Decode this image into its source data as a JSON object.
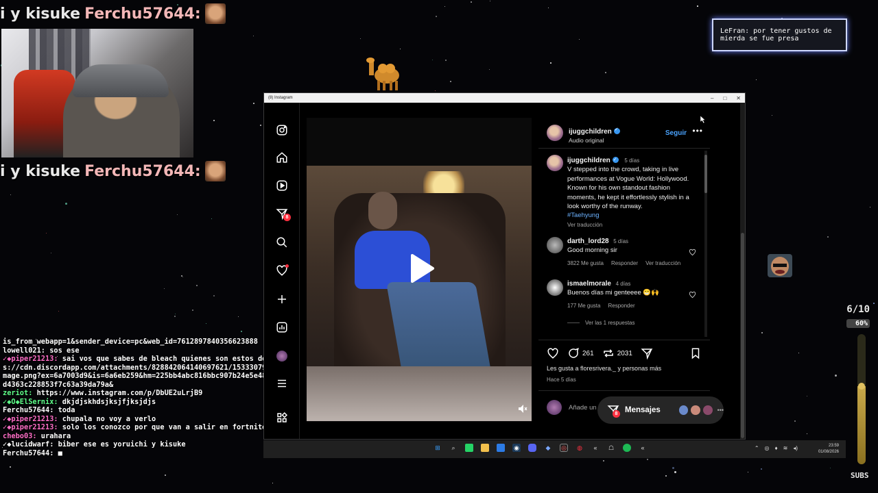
{
  "overlay": {
    "sub_banner_prefix": "i y kisuke",
    "sub_banner_name": "Ferchu57644:",
    "alert_text": "LeFran: por tener gustos de mierda se fue presa",
    "goal_count": "6/10",
    "goal_percent": "60%",
    "goal_progress": 0.6,
    "goal_label": "SUBS"
  },
  "chat": [
    {
      "user": "",
      "text": "is_from_webapp=1&sender_device=pc&web_id=7612897840356623888",
      "color": "plain"
    },
    {
      "user": "lowell021:",
      "text": "sos ese",
      "color": "plain"
    },
    {
      "user": "✓◆piper21213:",
      "text": "sai vos que sabes de bleach quienes son estos dos vro https://cdn.discordapp.com/attachments/828842064140697621/1533307993741856909/image.png?ex=6a7003d9&is=6a6eb259&hm=225bb4abc816bbc907b24e5e48a3c2d011c660dd4363c228853f7c63a39da79a&",
      "color": "pink"
    },
    {
      "user": "zeriot:",
      "text": "https://www.instagram.com/p/DbUE2uLrjB9",
      "color": "green"
    },
    {
      "user": "✓◆O◆ElSernix:",
      "text": "dkjdjskhdsjksjfjksjdjs",
      "color": "green"
    },
    {
      "user": "Ferchu57644:",
      "text": "toda",
      "color": "plain"
    },
    {
      "user": "✓◆piper21213:",
      "text": "chupala no voy a verlo",
      "color": "pink"
    },
    {
      "user": "✓◆piper21213:",
      "text": "solo los conozco por que van a salir en fortnite",
      "color": "pink"
    },
    {
      "user": "chebo03:",
      "text": "urahara",
      "color": "pink"
    },
    {
      "user": "✓◆lucidwarf:",
      "text": "biber ese es yoruichi y kisuke",
      "color": "plain"
    },
    {
      "user": "Ferchu57644:",
      "text": "■",
      "color": "plain"
    }
  ],
  "window": {
    "title": "(8) Instagram",
    "minimize": "–",
    "maximize": "□",
    "close": "✕"
  },
  "nav": {
    "notification_count": "8",
    "icons": [
      "instagram-logo-icon",
      "home-icon",
      "reels-icon",
      "direct-icon",
      "search-icon",
      "notifications-heart-icon",
      "create-plus-icon",
      "dashboard-icon",
      "profile-avatar",
      "more-menu-icon",
      "also-from-meta-icon"
    ]
  },
  "post": {
    "author": "ijuggchildren",
    "audio": "Audio original",
    "follow_label": "Seguir",
    "more": "•••",
    "caption_age": "5 días",
    "caption": "V stepped into the crowd, taking in live performances at Vogue World: Hollywood. Known for his own standout fashion moments, he kept it effortlessly stylish in a look worthy of the runway.",
    "hashtag": "#Taehyung",
    "translate": "Ver traducción",
    "comments": [
      {
        "user": "darth_lord28",
        "age": "5 días",
        "text": "Good morning sir",
        "likes": "3822 Me gusta",
        "reply": "Responder",
        "translate": "Ver traducción"
      },
      {
        "user": "ismaelmorale",
        "age": "4 días",
        "text": "Buenos días mi genteeee 😁🙌",
        "likes": "177 Me gusta",
        "reply": "Responder",
        "view_replies": "Ver las 1 respuestas"
      }
    ],
    "comment_count": "261",
    "share_count": "2031",
    "liked_by": "Les gusta a floresrivera._ y personas más",
    "posted_ago": "Hace 5 días",
    "add_comment_placeholder": "Añade un",
    "messages_label": "Mensajes",
    "messages_badge": "8"
  },
  "taskbar": {
    "time": "23:59",
    "date": "01/08/2026"
  },
  "colors": {
    "instagram_link": "#4aa3ff",
    "notification_red": "#ff3040",
    "verified_blue": "#3897f0",
    "chat_pink": "#ff6ec7",
    "chat_green": "#5fff8a"
  }
}
